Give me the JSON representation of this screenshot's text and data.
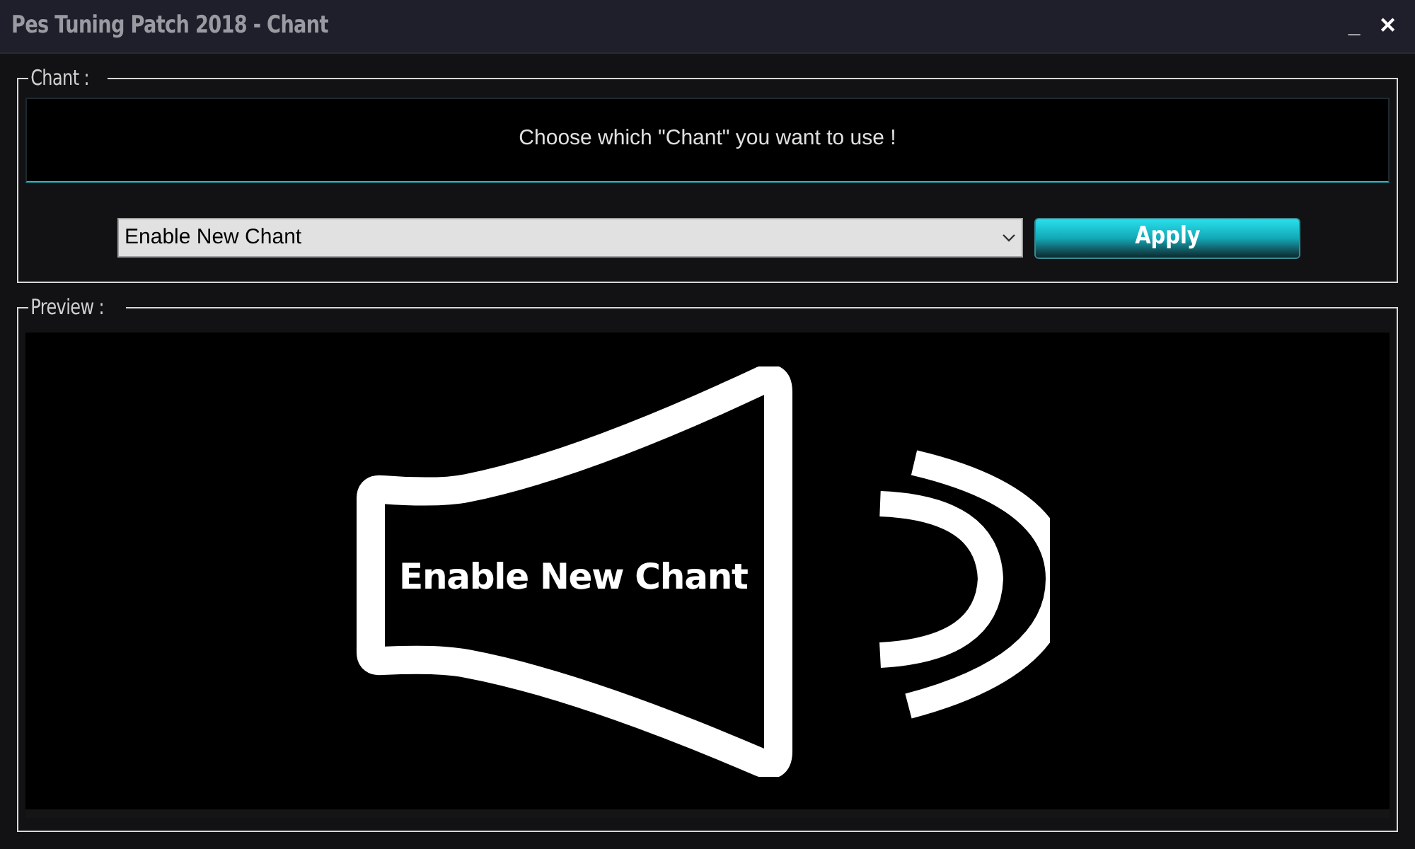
{
  "window": {
    "title": "Pes Tuning Patch 2018 - Chant",
    "controls": [
      "_",
      "✕"
    ]
  },
  "chant_group": {
    "legend": "Chant :",
    "message": "Choose which \"Chant\" you want to use !",
    "select": {
      "value": "Enable New Chant"
    },
    "apply_button": "Apply"
  },
  "preview_group": {
    "legend": "Preview :",
    "image_caption": "Enable New Chant"
  }
}
